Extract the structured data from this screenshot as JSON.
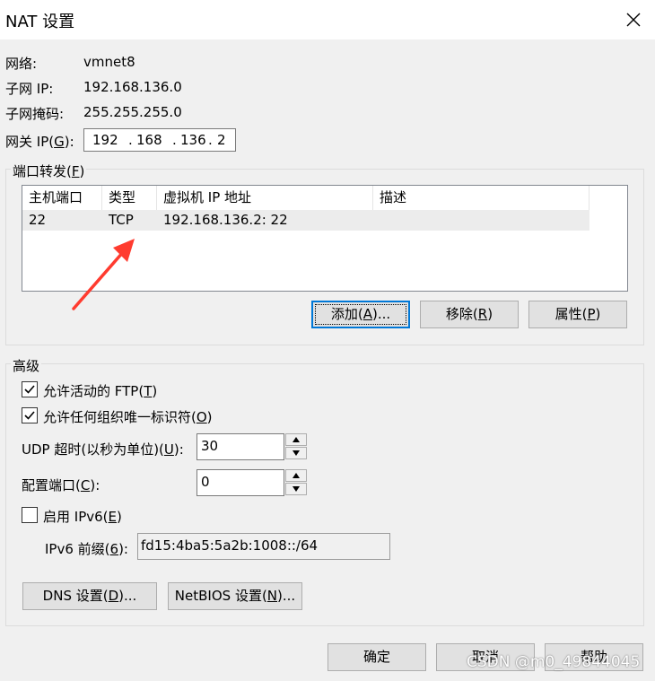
{
  "window": {
    "title": "NAT 设置"
  },
  "info": {
    "network_label": "网络:",
    "network_value": "vmnet8",
    "subnet_ip_label": "子网 IP:",
    "subnet_ip_value": "192.168.136.0",
    "subnet_mask_label": "子网掩码:",
    "subnet_mask_value": "255.255.255.0",
    "gateway_label_pre": "网关 IP(",
    "gateway_label_key": "G",
    "gateway_label_post": "):",
    "gateway_octets": [
      "192",
      ".",
      "168",
      ".",
      "136",
      ".",
      "2"
    ]
  },
  "port_forwarding": {
    "title_pre": "端口转发(",
    "title_key": "F",
    "title_post": ")",
    "columns": [
      "主机端口",
      "类型",
      "虚拟机 IP 地址",
      "描述"
    ],
    "rows": [
      {
        "host_port": "22",
        "type": "TCP",
        "vm_ip": "192.168.136.2: 22",
        "desc": ""
      }
    ],
    "add_pre": "添加(",
    "add_key": "A",
    "add_post": ")...",
    "remove_pre": "移除(",
    "remove_key": "R",
    "remove_post": ")",
    "props_pre": "属性(",
    "props_key": "P",
    "props_post": ")"
  },
  "advanced": {
    "title": "高级",
    "active_ftp_pre": "允许活动的 FTP(",
    "active_ftp_key": "T",
    "active_ftp_post": ")",
    "active_ftp_checked": true,
    "oui_pre": "允许任何组织唯一标识符(",
    "oui_key": "O",
    "oui_post": ")",
    "oui_checked": true,
    "udp_pre": "UDP 超时(以秒为单位)(",
    "udp_key": "U",
    "udp_post": "):",
    "udp_value": "30",
    "config_port_pre": "配置端口(",
    "config_port_key": "C",
    "config_port_post": "):",
    "config_port_value": "0",
    "ipv6_pre": "启用 IPv6(",
    "ipv6_key": "E",
    "ipv6_post": ")",
    "ipv6_checked": false,
    "ipv6_prefix_pre": "IPv6 前缀(",
    "ipv6_prefix_key": "6",
    "ipv6_prefix_post": "):",
    "ipv6_prefix_value": "fd15:4ba5:5a2b:1008::/64",
    "dns_pre": "DNS 设置(",
    "dns_key": "D",
    "dns_post": ")...",
    "netbios_pre": "NetBIOS 设置(",
    "netbios_key": "N",
    "netbios_post": ")..."
  },
  "footer": {
    "ok": "确定",
    "cancel": "取消",
    "help": "帮助"
  },
  "watermark": "CSDN @m0_49844045",
  "colors": {
    "arrow": "#ff3b2f",
    "focus_border": "#0078d7"
  }
}
